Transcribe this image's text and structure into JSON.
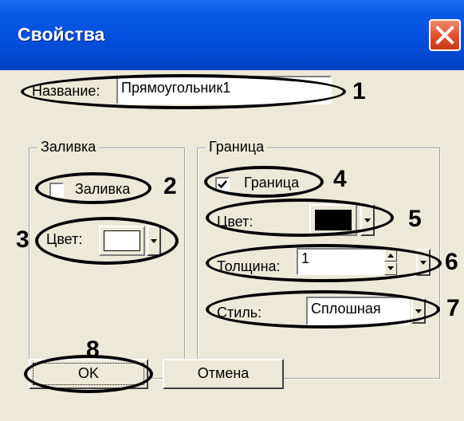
{
  "window": {
    "title": "Свойства"
  },
  "name_row": {
    "label": "Название:",
    "value": "Прямоугольник1"
  },
  "fill_group": {
    "title": "Заливка",
    "checkbox_label": "Заливка",
    "checked": false,
    "color_label": "Цвет:",
    "color_value": "#ffffff"
  },
  "border_group": {
    "title": "Граница",
    "checkbox_label": "Граница",
    "checked": true,
    "color_label": "Цвет:",
    "color_value": "#000000",
    "thickness_label": "Толщина:",
    "thickness_value": "1",
    "style_label": "Стиль:",
    "style_value": "Сплошная"
  },
  "buttons": {
    "ok": "OK",
    "cancel": "Отмена"
  },
  "callouts": [
    "1",
    "2",
    "3",
    "4",
    "5",
    "6",
    "7",
    "8"
  ],
  "colors": {
    "titlebar": "#0450df",
    "dialog_bg": "#ece9d8",
    "close_button": "#e2542d"
  },
  "icons": {
    "close": "close-icon",
    "checkmark": "checkmark-icon",
    "dropdown": "chevron-down-icon"
  }
}
